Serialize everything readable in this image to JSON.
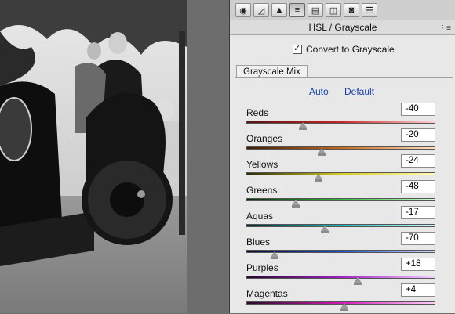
{
  "toolbar": {
    "icons": [
      "aperture-icon",
      "tone-curve-icon",
      "detail-icon",
      "hsl-grayscale-icon",
      "split-toning-icon",
      "lens-corrections-icon",
      "camera-calibration-icon",
      "presets-icon"
    ],
    "active_index": 3
  },
  "panel": {
    "title": "HSL / Grayscale",
    "convert_label": "Convert to Grayscale",
    "convert_checked": true,
    "tab_label": "Grayscale Mix",
    "auto_label": "Auto",
    "default_label": "Default"
  },
  "sliders": [
    {
      "label": "Reds",
      "value": "-40",
      "num": -40,
      "gradient": [
        "#5a1212",
        "#c8262a",
        "#ffd0d0"
      ]
    },
    {
      "label": "Oranges",
      "value": "-20",
      "num": -20,
      "gradient": [
        "#3a1f08",
        "#c56a1a",
        "#ffe0c0"
      ]
    },
    {
      "label": "Yellows",
      "value": "-24",
      "num": -24,
      "gradient": [
        "#2b2b08",
        "#d6cc20",
        "#fffbb0"
      ]
    },
    {
      "label": "Greens",
      "value": "-48",
      "num": -48,
      "gradient": [
        "#0a2a0a",
        "#2fbe3a",
        "#d0ffd0"
      ]
    },
    {
      "label": "Aquas",
      "value": "-17",
      "num": -17,
      "gradient": [
        "#082a2a",
        "#1bb8b8",
        "#d0ffff"
      ]
    },
    {
      "label": "Blues",
      "value": "-70",
      "num": -70,
      "gradient": [
        "#08082a",
        "#1a4fd6",
        "#d0dcff"
      ]
    },
    {
      "label": "Purples",
      "value": "+18",
      "num": 18,
      "gradient": [
        "#240a2a",
        "#a11fc4",
        "#f2d0ff"
      ]
    },
    {
      "label": "Magentas",
      "value": "+4",
      "num": 4,
      "gradient": [
        "#2a0a24",
        "#d21ab8",
        "#ffd0f6"
      ]
    }
  ]
}
